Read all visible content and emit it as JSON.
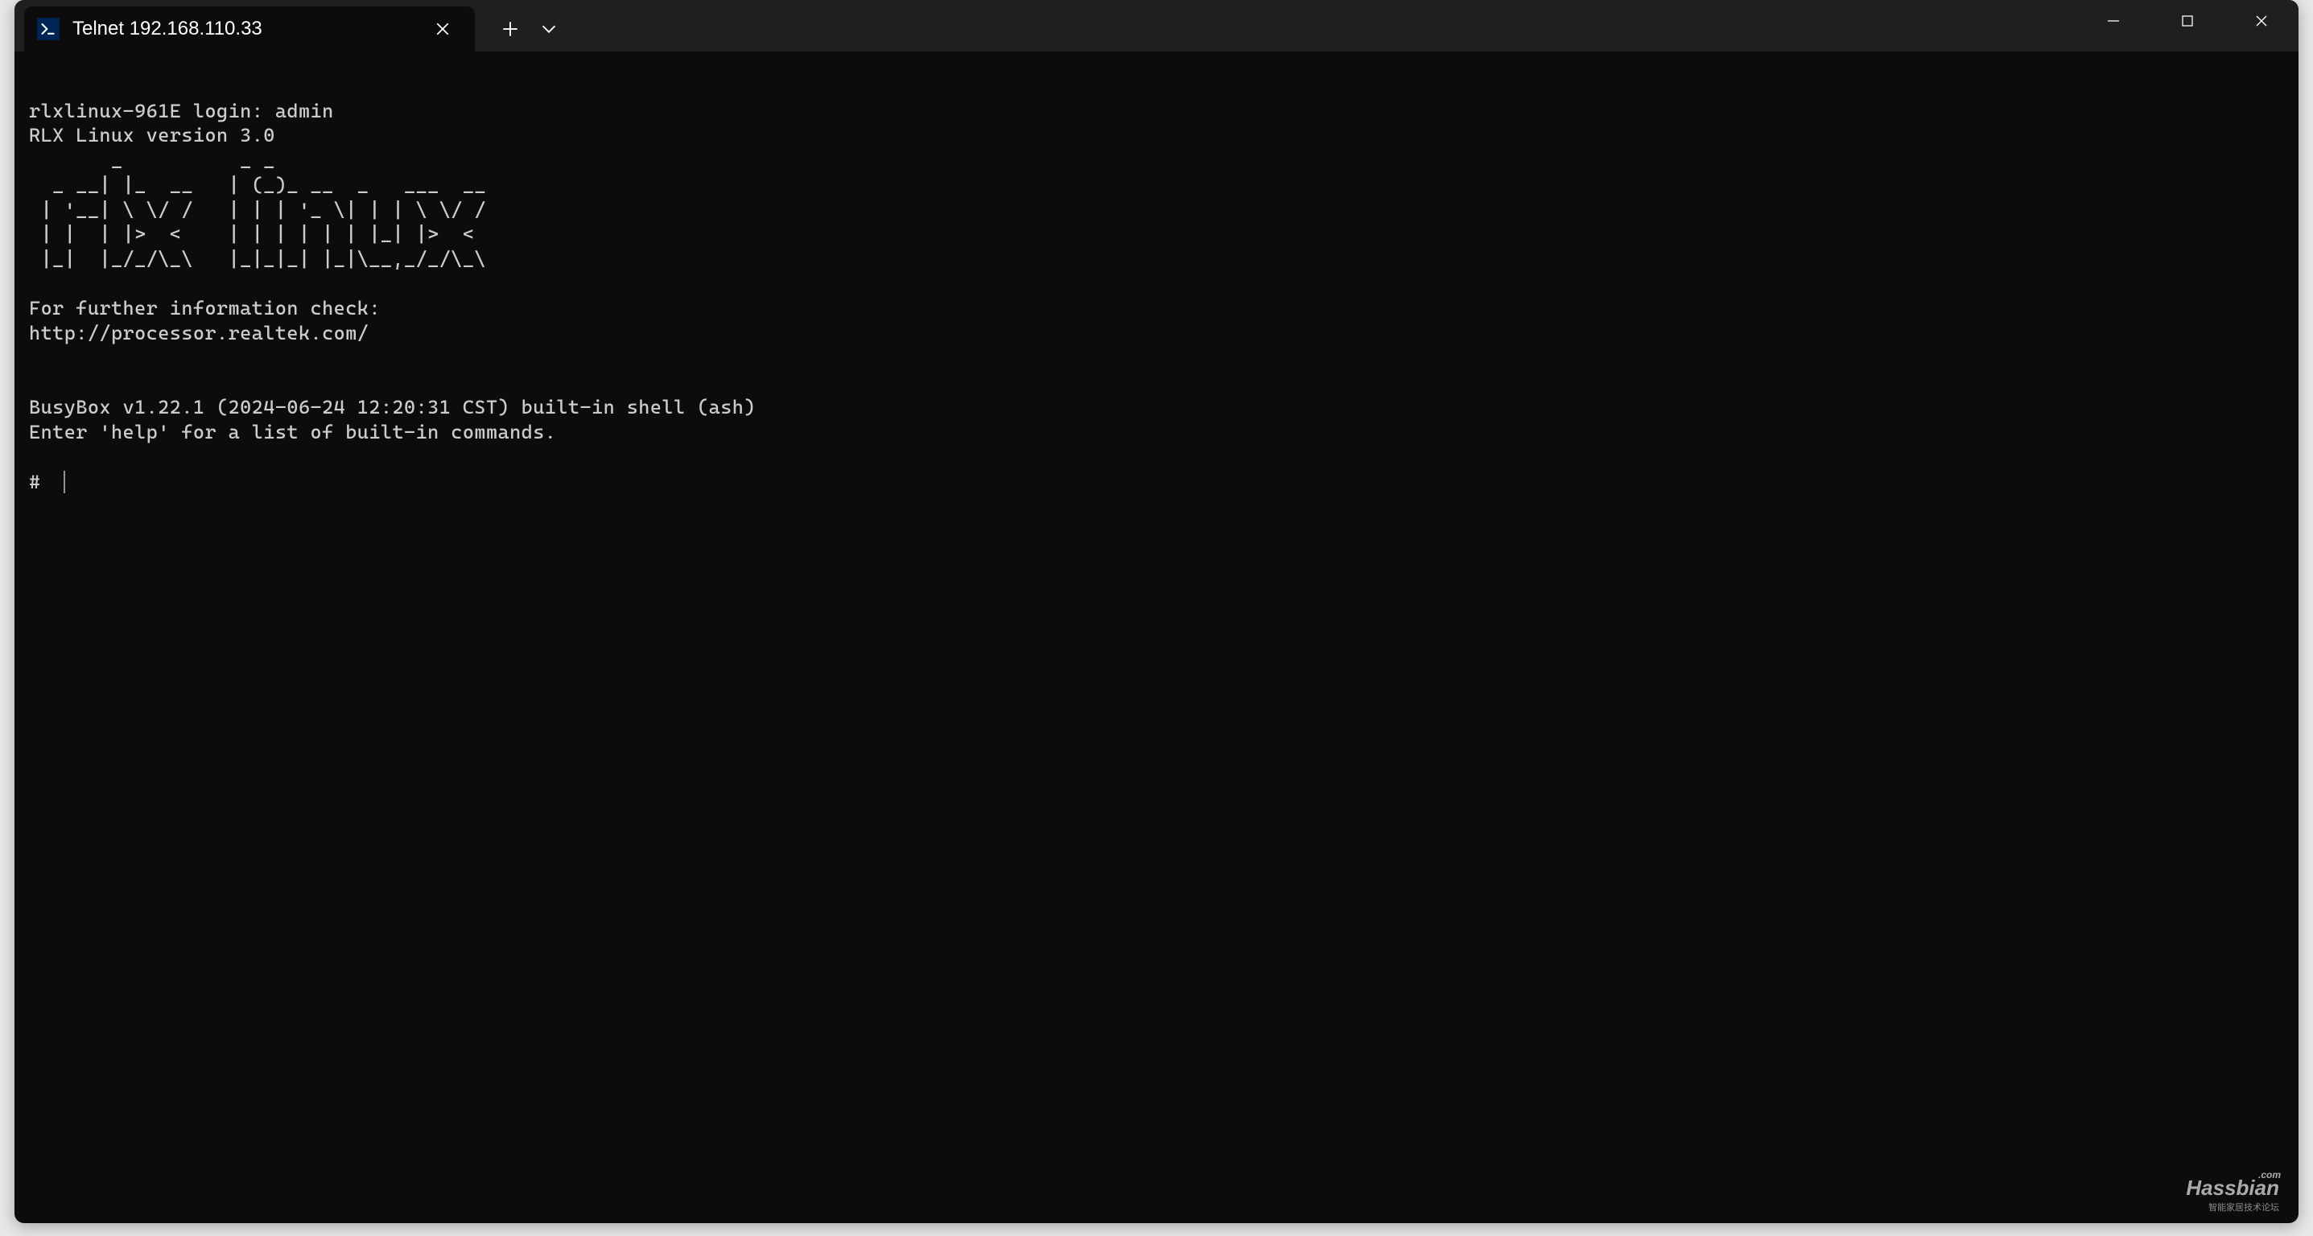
{
  "window": {
    "tab_title": "Telnet 192.168.110.33"
  },
  "terminal": {
    "login_line": "rlxlinux-961E login: admin",
    "version_line": "RLX Linux version 3.0",
    "ascii_art": "       _          _ _\n  _ __| |_  __   | (_)_ __  _   ___  __\n | '__| \\ \\/ /   | | | '_ \\| | | \\ \\/ /\n | |  | |>  <    | | | | | | |_| |>  <\n |_|  |_/_/\\_\\   |_|_|_| |_|\\__,_/_/\\_\\",
    "info_line1": "For further information check:",
    "info_line2": "http://processor.realtek.com/",
    "busybox_line": "BusyBox v1.22.1 (2024-06-24 12:20:31 CST) built-in shell (ash)",
    "help_line": "Enter 'help' for a list of built-in commands.",
    "prompt": "# "
  },
  "watermark": {
    "main": "Hassbian",
    "suffix": ".com",
    "sub": "智能家居技术论坛"
  }
}
